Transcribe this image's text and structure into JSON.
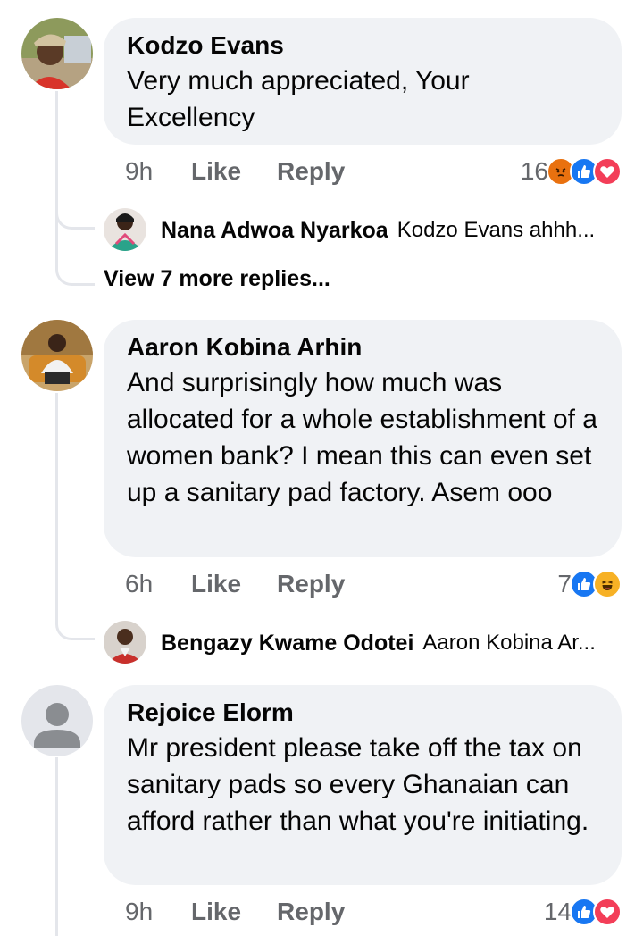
{
  "comments": [
    {
      "author": "Kodzo Evans",
      "text": "Very much appreciated, Your Excellency",
      "time": "9h",
      "like_label": "Like",
      "reply_label": "Reply",
      "reaction_count": "16",
      "reactions": [
        "angry-icon",
        "like-icon",
        "love-icon"
      ],
      "replies": [
        {
          "author": "Nana Adwoa Nyarkoa",
          "preview": "Kodzo Evans ahhh..."
        }
      ],
      "view_more": "View 7 more replies..."
    },
    {
      "author": "Aaron Kobina Arhin",
      "text": "And surprisingly how much was allocated for a whole establishment of a women bank? I mean this can even set up a sanitary pad factory. Asem ooo",
      "time": "6h",
      "like_label": "Like",
      "reply_label": "Reply",
      "reaction_count": "7",
      "reactions": [
        "like-icon",
        "haha-icon"
      ],
      "replies": [
        {
          "author": "Bengazy Kwame Odotei",
          "preview": "Aaron Kobina Ar..."
        }
      ]
    },
    {
      "author": "Rejoice Elorm",
      "text": "Mr president please take off the tax on sanitary pads so every Ghanaian can afford rather than what you're initiating.",
      "time": "9h",
      "like_label": "Like",
      "reply_label": "Reply",
      "reaction_count": "14",
      "reactions": [
        "like-icon",
        "love-icon"
      ]
    }
  ],
  "colors": {
    "bubble": "#f0f2f5",
    "meta_text": "#65676b",
    "thread_line": "#e4e6eb",
    "like": "#1877f2",
    "love": "#f33e58",
    "angry": "#e9710f",
    "haha": "#f7b125"
  }
}
